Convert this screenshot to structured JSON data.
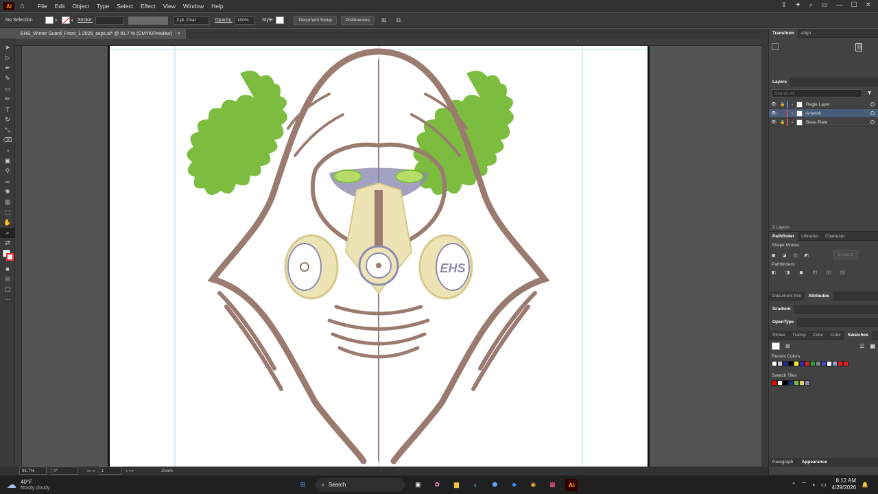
{
  "app": {
    "logo_text": "Ai",
    "menus": [
      "File",
      "Edit",
      "Object",
      "Type",
      "Select",
      "Effect",
      "View",
      "Window",
      "Help"
    ]
  },
  "control_bar": {
    "selection": "No Selection",
    "stroke_label": "Stroke:",
    "brush": "2 pt. Oval",
    "opacity_label": "Opacity:",
    "opacity_value": "100%",
    "style_label": "Style:",
    "document_setup": "Document Setup",
    "preferences": "Preferences"
  },
  "document": {
    "tab_title": "EHS_Winter Guard_Front_1 2026_seps.ai* @ 91.7 % (CMYK/Preview)",
    "close": "×"
  },
  "art": {
    "lettering": "EHS",
    "colors": {
      "hood": "#9b7b70",
      "smoke": "#7cbd3f",
      "mask": "#ede3b5",
      "face": "#8b8bb0",
      "eyes": "#b8dc6a"
    }
  },
  "status": {
    "zoom": "91.7%",
    "angle": "0°",
    "artboard": "1",
    "mode": "Zoom"
  },
  "panels": {
    "transform_tab": "Transform",
    "align_tab": "Align",
    "layers_title": "Layers",
    "search_placeholder": "Search All",
    "layers": [
      {
        "name": "Regie Layer",
        "color": "#4f7fe0"
      },
      {
        "name": "Artwork",
        "color": "#d14f4f"
      },
      {
        "name": "Base Plate",
        "color": "#d14f4f"
      }
    ],
    "layers_count": "3 Layers",
    "pathfinder_tab": "Pathfinder",
    "libraries_tab": "Libraries",
    "character_tab": "Character",
    "shape_modes": "Shape Modes:",
    "expand": "Expand",
    "pathfinders": "Pathfinders:",
    "docinfo_tab": "Document Info",
    "attributes_tab": "Attributes",
    "gradient_tab": "Gradient",
    "opentype_tab": "OpenType",
    "stroke_tab": "Stroke",
    "transp_tab": "Transp",
    "color_tab": "Color",
    "colorguide_tab": "Color",
    "swatches_tab": "Swatches",
    "recent_colors": "Recent Colors",
    "recent_swatches": [
      "#ffffff",
      "#cccccc",
      "#1f2a8a",
      "#000000",
      "#f4ea2a",
      "#2a2ab0",
      "#e02020",
      "#2a9a3a",
      "#808080",
      "#4a4ab0",
      "#ffffff",
      "#9aa0c0",
      "#e02020",
      "#e02020"
    ],
    "swatch_tiles": "Swatch Tiles",
    "tile_swatches": [
      "#ff0000",
      "#ffffff",
      "#000000",
      "#1f2a8a",
      "#7cbd3f",
      "#e0d070",
      "#8b8bb0"
    ],
    "paragraph_tab": "Paragraph",
    "appearance_tab": "Appearance"
  },
  "taskbar": {
    "temp": "40°F",
    "weather": "Mostly cloudy",
    "search": "Search",
    "time": "8:12 AM",
    "date": "4/29/2026"
  }
}
